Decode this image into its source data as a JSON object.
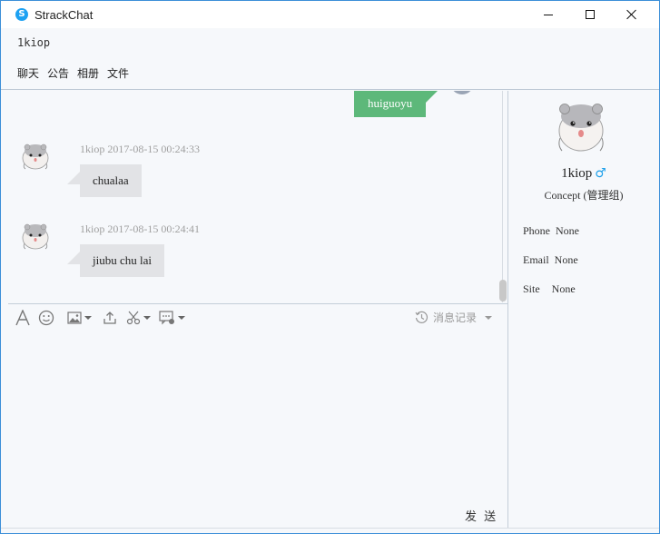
{
  "window": {
    "title": "StrackChat",
    "app_icon_glyph": "S",
    "controls": [
      "minimize-icon",
      "maximize-icon",
      "close-icon"
    ]
  },
  "header": {
    "contact_name": "1kiop",
    "tabs": [
      {
        "label": "聊天"
      },
      {
        "label": "公告"
      },
      {
        "label": "相册"
      },
      {
        "label": "文件"
      }
    ]
  },
  "chat": {
    "outgoing": [
      {
        "text": "huiguoyu"
      }
    ],
    "incoming": [
      {
        "sender": "1kiop",
        "timestamp": "2017-08-15 00:24:33",
        "meta": "1kiop 2017-08-15 00:24:33",
        "text": "chualaa"
      },
      {
        "sender": "1kiop",
        "timestamp": "2017-08-15 00:24:41",
        "meta": "1kiop 2017-08-15 00:24:41",
        "text": "jiubu chu lai"
      }
    ],
    "colors": {
      "outgoing_bubble": "#5db87a",
      "incoming_bubble": "#e2e3e6",
      "accent": "#1da1f2"
    }
  },
  "toolbar": {
    "icons": [
      "font-icon",
      "emoji-icon",
      "image-icon",
      "upload-icon",
      "scissors-icon",
      "message-settings-icon"
    ],
    "history_label": "消息记录",
    "history_icon": "clock-history-icon"
  },
  "composer": {
    "send_label": "发 送"
  },
  "profile": {
    "name": "1kiop",
    "gender_glyph": "♂",
    "role": "Concept (管理组)",
    "fields": [
      {
        "label": "Phone",
        "value": "None"
      },
      {
        "label": "Email",
        "value": "None"
      },
      {
        "label": "Site",
        "value": "None"
      }
    ]
  }
}
